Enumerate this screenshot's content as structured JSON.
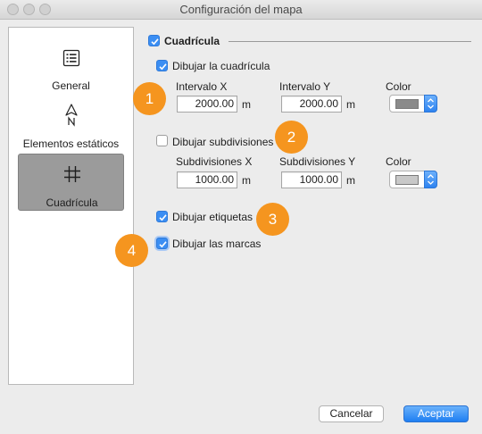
{
  "window": {
    "title": "Configuración del mapa"
  },
  "sidebar": {
    "items": [
      {
        "label": "General",
        "icon": "list-icon",
        "selected": false
      },
      {
        "label": "Elementos estáticos",
        "icon": "north-arrow-icon",
        "selected": false
      },
      {
        "label": "Cuadrícula",
        "icon": "grid-icon",
        "selected": true
      }
    ]
  },
  "grid_section": {
    "title": "Cuadrícula",
    "enabled": true,
    "draw_grid": {
      "label": "Dibujar la cuadrícula",
      "checked": true
    },
    "interval_x": {
      "label": "Intervalo X",
      "value": "2000.00",
      "unit": "m"
    },
    "interval_y": {
      "label": "Intervalo Y",
      "value": "2000.00",
      "unit": "m"
    },
    "color": {
      "label": "Color",
      "value": "#8a8a8a"
    },
    "draw_subdivisions": {
      "label": "Dibujar subdivisiones",
      "checked": false
    },
    "subdiv_x": {
      "label": "Subdivisiones X",
      "value": "1000.00",
      "unit": "m"
    },
    "subdiv_y": {
      "label": "Subdivisiones Y",
      "value": "1000.00",
      "unit": "m"
    },
    "subdiv_color": {
      "label": "Color",
      "value": "#c8c8c8"
    },
    "draw_labels": {
      "label": "Dibujar etiquetas",
      "checked": true
    },
    "draw_ticks": {
      "label": "Dibujar las marcas",
      "checked": true
    }
  },
  "callouts": [
    "1",
    "2",
    "3",
    "4"
  ],
  "footer": {
    "cancel_label": "Cancelar",
    "accept_label": "Aceptar"
  },
  "colors": {
    "accent": "#3b8ef3",
    "callout": "#f5951f"
  }
}
